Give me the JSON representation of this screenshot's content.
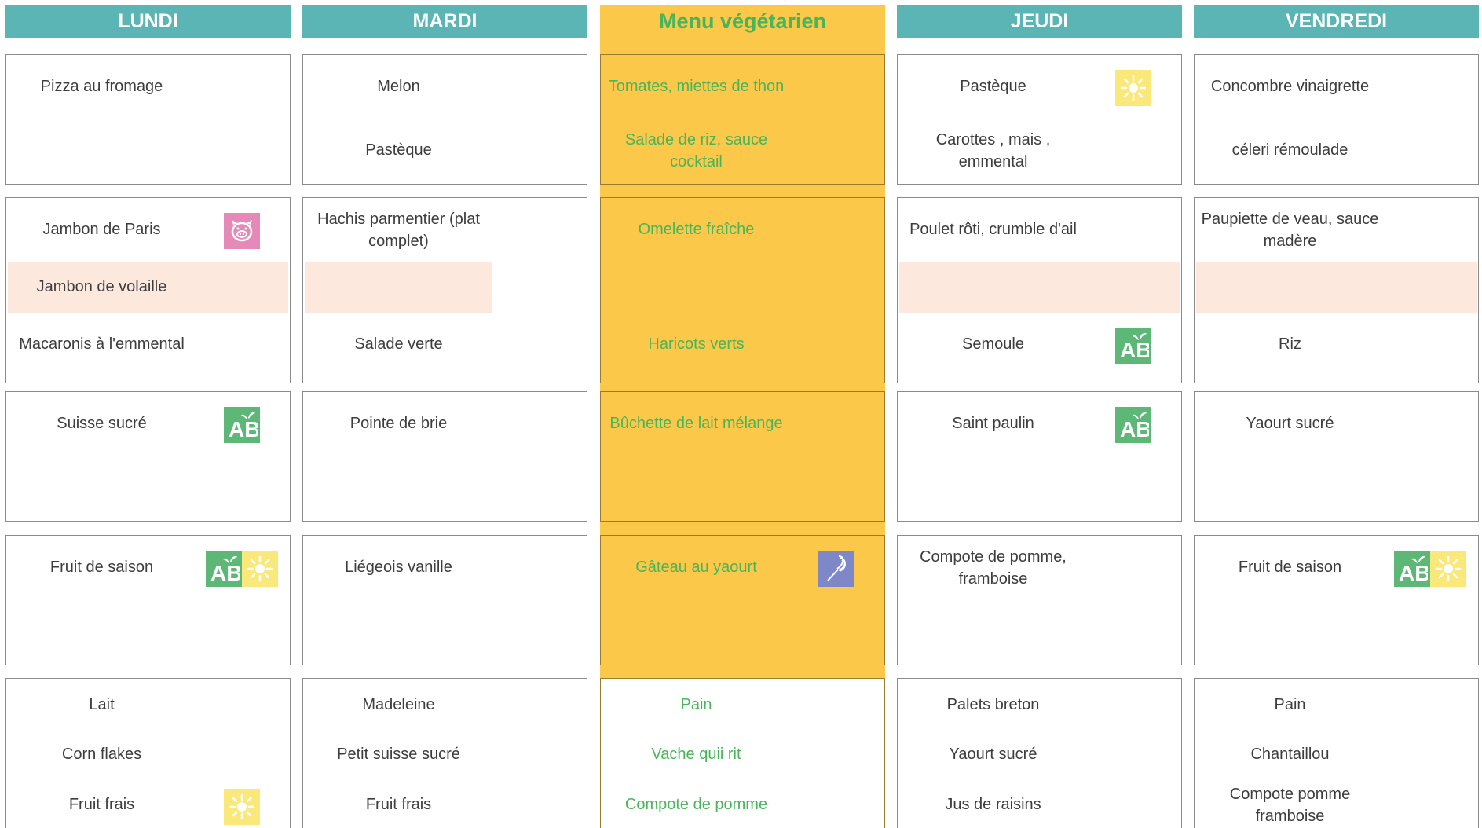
{
  "days": {
    "lundi": {
      "header": "LUNDI",
      "entree": [
        "Pizza au fromage"
      ],
      "plat": "Jambon de Paris",
      "plat_alt": "Jambon de volaille",
      "accompagnement": "Macaronis à l'emmental",
      "laitage": "Suisse sucré",
      "dessert": "Fruit de saison",
      "gouter": [
        "Lait",
        "Corn flakes",
        "Fruit frais"
      ]
    },
    "mardi": {
      "header": "MARDI",
      "entree": [
        "Melon",
        "Pastèque"
      ],
      "plat": "Hachis parmentier (plat complet)",
      "plat_alt": "",
      "accompagnement": "Salade verte",
      "laitage": "Pointe de brie",
      "dessert": "Liégeois vanille",
      "gouter": [
        "Madeleine",
        "Petit suisse sucré",
        "Fruit frais"
      ]
    },
    "mercredi": {
      "header": "Menu végétarien",
      "entree": [
        "Tomates, miettes de thon",
        "Salade de riz, sauce cocktail"
      ],
      "plat": "Omelette fraîche",
      "accompagnement": "Haricots verts",
      "laitage": "Bûchette de lait mélange",
      "dessert": "Gâteau au yaourt",
      "gouter": [
        "Pain",
        "Vache quii rit",
        "Compote de pomme"
      ]
    },
    "jeudi": {
      "header": "JEUDI",
      "entree": [
        "Pastèque",
        "Carottes , mais , emmental"
      ],
      "plat": "Poulet rôti, crumble d'ail",
      "plat_alt": "",
      "accompagnement": "Semoule",
      "laitage": "Saint paulin",
      "dessert": "Compote de pomme, framboise",
      "gouter": [
        "Palets breton",
        "Yaourt sucré",
        "Jus de raisins"
      ]
    },
    "vendredi": {
      "header": "VENDREDI",
      "entree": [
        "Concombre vinaigrette",
        "céleri rémoulade"
      ],
      "plat": "Paupiette de veau, sauce madère",
      "plat_alt": "",
      "accompagnement": "Riz",
      "laitage": "Yaourt sucré",
      "dessert": "Fruit de saison",
      "gouter": [
        "Pain",
        "Chantaillou",
        "Compote pomme framboise"
      ]
    }
  },
  "icons": {
    "bio": "bio-ab-label-icon",
    "seasonal": "sun-seasonal-icon",
    "pork": "pig-pork-icon",
    "homemade": "whisk-homemade-icon"
  },
  "colors": {
    "header_bg": "#5ab5b4",
    "vegetarian_bg": "#fcc84a",
    "vegetarian_text": "#48b55a",
    "alternative_row_bg": "#fde8dd",
    "bio_green": "#5db878",
    "sun_yellow": "#fbe87a",
    "pork_pink": "#e58ab8",
    "homemade_purple": "#7e88c8"
  }
}
